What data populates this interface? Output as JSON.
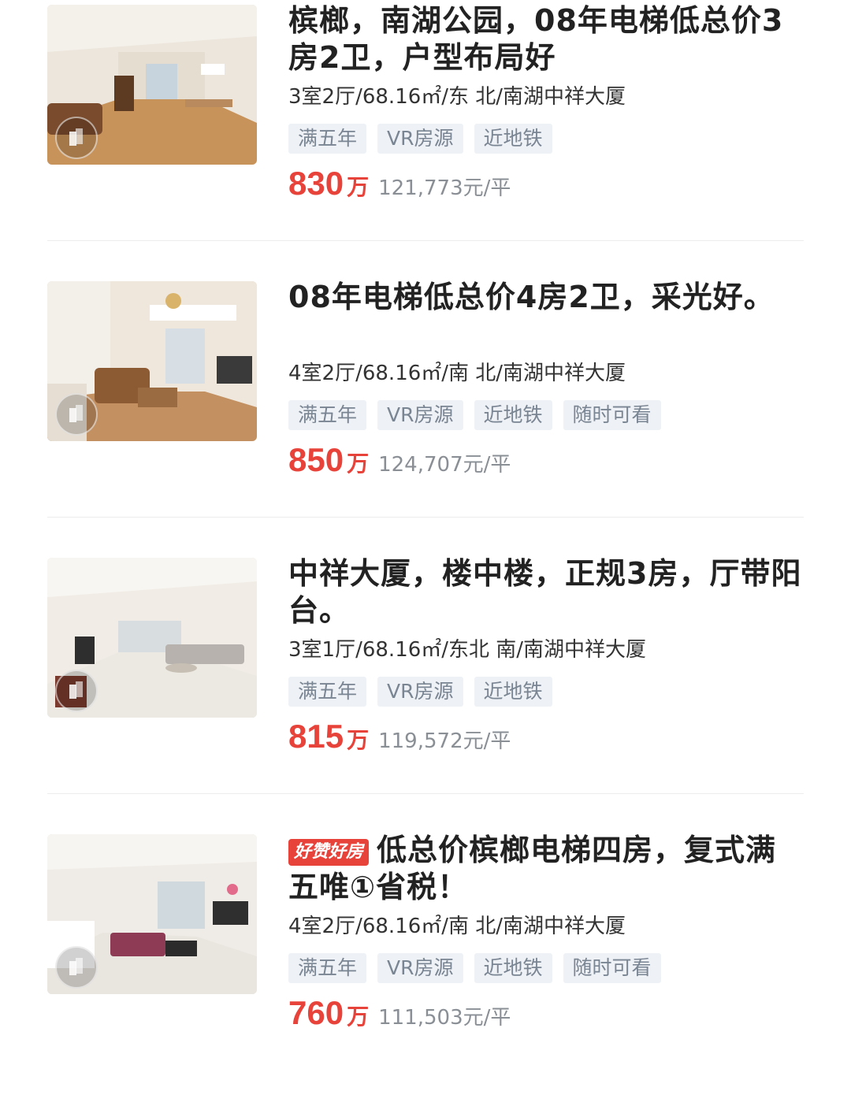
{
  "listings": [
    {
      "badge": "",
      "title": "槟榔，南湖公园，08年电梯低总价3房2卫，户型布局好",
      "meta": "3室2厅/68.16㎡/东 北/南湖中祥大厦",
      "tags": [
        "满五年",
        "VR房源",
        "近地铁"
      ],
      "price": "830",
      "price_unit": "万",
      "unit_price": "121,773元/平"
    },
    {
      "badge": "",
      "title": "08年电梯低总价4房2卫，采光好。",
      "meta": "4室2厅/68.16㎡/南 北/南湖中祥大厦",
      "tags": [
        "满五年",
        "VR房源",
        "近地铁",
        "随时可看"
      ],
      "price": "850",
      "price_unit": "万",
      "unit_price": "124,707元/平"
    },
    {
      "badge": "",
      "title": "中祥大厦，楼中楼，正规3房，厅带阳台。",
      "meta": "3室1厅/68.16㎡/东北 南/南湖中祥大厦",
      "tags": [
        "满五年",
        "VR房源",
        "近地铁"
      ],
      "price": "815",
      "price_unit": "万",
      "unit_price": "119,572元/平"
    },
    {
      "badge": "好赞好房",
      "title": "低总价槟榔电梯四房，复式满五唯①省税！",
      "meta": "4室2厅/68.16㎡/南 北/南湖中祥大厦",
      "tags": [
        "满五年",
        "VR房源",
        "近地铁",
        "随时可看"
      ],
      "price": "760",
      "price_unit": "万",
      "unit_price": "111,503元/平"
    }
  ],
  "icons": {
    "vr": "vr-cube-icon"
  },
  "colors": {
    "price": "#e8433a",
    "tag_bg": "#eef1f5",
    "tag_text": "#7a8593",
    "badge_bg": "#e8433a"
  }
}
